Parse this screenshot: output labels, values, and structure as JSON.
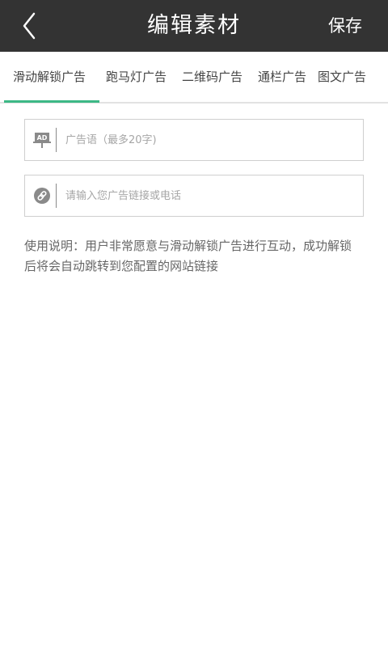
{
  "header": {
    "back_icon": "chevron-left-icon",
    "title": "编辑素材",
    "save_label": "保存",
    "background": "#333333"
  },
  "tabs": {
    "items": [
      {
        "label": "滑动解锁广告",
        "selected": true
      },
      {
        "label": "跑马灯广告",
        "selected": false
      },
      {
        "label": "二维码广告",
        "selected": false
      },
      {
        "label": "通栏广告",
        "selected": false
      },
      {
        "label": "图文广告",
        "selected": false
      }
    ],
    "indicator_color": "#3cb886"
  },
  "form": {
    "ad_slogan": {
      "icon": "ad-icon",
      "value": "",
      "placeholder": "广告语（最多20字)"
    },
    "link": {
      "icon": "link-icon",
      "value": "",
      "placeholder": "请输入您广告链接或电话"
    }
  },
  "instructions": "使用说明：用户非常愿意与滑动解锁广告进行互动，成功解锁 后将会自动跳转到您配置的网站链接"
}
